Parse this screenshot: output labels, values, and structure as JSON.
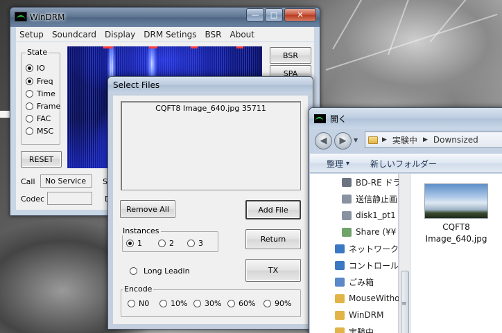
{
  "windrm": {
    "title": "WinDRM",
    "window_buttons": {
      "minimize": "—",
      "maximize": "□",
      "close": "✕"
    },
    "menu": [
      "Setup",
      "Soundcard",
      "Display",
      "DRM Setings",
      "BSR",
      "About"
    ],
    "state_group": {
      "title": "State",
      "options": [
        {
          "label": "IO",
          "selected": true
        },
        {
          "label": "Freq",
          "selected": true
        },
        {
          "label": "Time",
          "selected": false
        },
        {
          "label": "Frame",
          "selected": false
        },
        {
          "label": "FAC",
          "selected": false
        },
        {
          "label": "MSC",
          "selected": false
        }
      ]
    },
    "reset_label": "RESET",
    "call_label": "Call",
    "call_value": "No Service",
    "codec_label": "Codec",
    "codec_value": "",
    "s_label_cut": "S",
    "d_label_cut": "D",
    "bsr_button": "BSR",
    "spa_button": "SPA"
  },
  "select_files": {
    "title": "Select Files",
    "file_entry": "CQFT8 Image_640.jpg   35711",
    "remove_all_label": "Remove All",
    "add_file_label": "Add File",
    "instances": {
      "title": "Instances",
      "options": [
        {
          "label": "1",
          "selected": true
        },
        {
          "label": "2",
          "selected": false
        },
        {
          "label": "3",
          "selected": false
        }
      ]
    },
    "return_label": "Return",
    "long_leadin_label": "Long Leadin",
    "tx_label": "TX",
    "encode": {
      "title": "Encode",
      "options": [
        {
          "label": "N0",
          "selected": false
        },
        {
          "label": "10%",
          "selected": false
        },
        {
          "label": "30%",
          "selected": false
        },
        {
          "label": "60%",
          "selected": false
        },
        {
          "label": "90%",
          "selected": false
        }
      ]
    }
  },
  "open_dialog": {
    "title": "開く",
    "address": [
      "実験中",
      "Downsized"
    ],
    "organize_label": "整理",
    "organize_arrow": "▾",
    "new_folder_label": "新しいフォルダー",
    "nav_items": [
      {
        "label": "BD-RE ドラ",
        "icon": "drive-icon",
        "color": "#6b7480"
      },
      {
        "label": "送信静止画",
        "icon": "network-drive-disconnected-icon",
        "color": "#8892a0"
      },
      {
        "label": "disk1_pt1",
        "icon": "network-drive-disconnected-icon",
        "color": "#8892a0"
      },
      {
        "label": "Share (¥¥",
        "icon": "network-drive-icon",
        "color": "#6fa36a"
      },
      {
        "label": "ネットワーク",
        "icon": "network-icon",
        "color": "#3a78c3"
      },
      {
        "label": "コントロール",
        "icon": "control-panel-icon",
        "color": "#3a78c3"
      },
      {
        "label": "ごみ箱",
        "icon": "recycle-bin-icon",
        "color": "#5a88c8"
      },
      {
        "label": "MouseWitho",
        "icon": "folder-icon",
        "color": "#e2b447"
      },
      {
        "label": "WinDRM",
        "icon": "folder-icon",
        "color": "#e2b447"
      },
      {
        "label": "実験中",
        "icon": "folder-icon",
        "color": "#e2b447"
      }
    ],
    "file_caption": "CQFT8 Image_640.jpg"
  },
  "colors": {
    "spectrum_bg": "#0b1060",
    "title_accent": "#2ad14a"
  }
}
